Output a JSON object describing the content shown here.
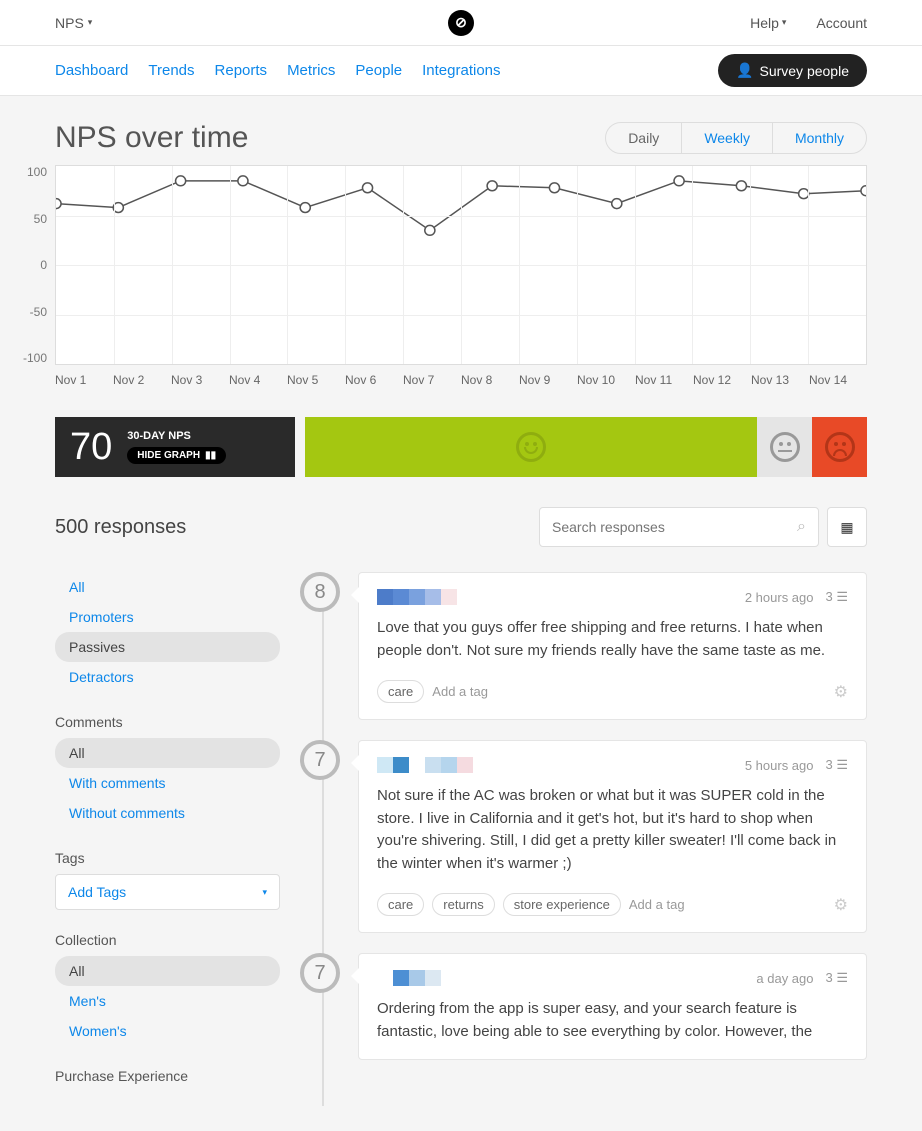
{
  "topbar": {
    "nps_label": "NPS",
    "help_label": "Help",
    "account_label": "Account"
  },
  "nav": {
    "tabs": [
      "Dashboard",
      "Trends",
      "Reports",
      "Metrics",
      "People",
      "Integrations"
    ],
    "survey_btn": "Survey people"
  },
  "chart_title": "NPS over time",
  "period": {
    "daily": "Daily",
    "weekly": "Weekly",
    "monthly": "Monthly"
  },
  "chart_data": {
    "type": "line",
    "title": "NPS over time",
    "xlabel": "",
    "ylabel": "",
    "ylim": [
      -100,
      100
    ],
    "yticks": [
      100,
      50,
      0,
      -50,
      -100
    ],
    "categories": [
      "Nov 1",
      "Nov 2",
      "Nov 3",
      "Nov 4",
      "Nov 5",
      "Nov 6",
      "Nov 7",
      "Nov 8",
      "Nov 9",
      "Nov 10",
      "Nov 11",
      "Nov 12",
      "Nov 13",
      "Nov 14"
    ],
    "values": [
      62,
      58,
      85,
      85,
      58,
      78,
      35,
      80,
      78,
      62,
      85,
      80,
      72,
      75
    ]
  },
  "nps_box": {
    "score": "70",
    "label": "30-DAY NPS",
    "hide_graph": "HIDE GRAPH"
  },
  "responses_count": "500 responses",
  "search": {
    "placeholder": "Search responses"
  },
  "filters": {
    "type": {
      "items": [
        "All",
        "Promoters",
        "Passives",
        "Detractors"
      ],
      "active": 2
    },
    "comments": {
      "title": "Comments",
      "items": [
        "All",
        "With comments",
        "Without comments"
      ],
      "active": 0
    },
    "tags": {
      "title": "Tags",
      "add_label": "Add Tags"
    },
    "collection": {
      "title": "Collection",
      "items": [
        "All",
        "Men's",
        "Women's"
      ],
      "active": 0
    },
    "purchase": {
      "title": "Purchase Experience"
    }
  },
  "responses": [
    {
      "score": "8",
      "time": "2 hours ago",
      "meta_count": "3",
      "text": "Love that you guys offer free shipping and free returns. I hate when people don't. Not sure my friends really have the same taste as me.",
      "tags": [
        "care"
      ],
      "add_tag": "Add a tag",
      "pixels": [
        "#4d7cc9",
        "#5b8ad4",
        "#7aa1de",
        "#a6bde8",
        "#f7e4e6"
      ]
    },
    {
      "score": "7",
      "time": "5 hours ago",
      "meta_count": "3",
      "text": "Not sure if the AC was broken or what but it was SUPER cold in the store. I live in California and it get's hot, but it's hard to shop when you're shivering. Still, I did get a pretty killer sweater! I'll come back in the winter when it's warmer ;)",
      "tags": [
        "care",
        "returns",
        "store experience"
      ],
      "add_tag": "Add a tag",
      "pixels": [
        "#cfe8f5",
        "#3d8cc9",
        "#ffffff",
        "#c9dff0",
        "#b5d5ed",
        "#f5dbe0"
      ]
    },
    {
      "score": "7",
      "time": "a day ago",
      "meta_count": "3",
      "text": "Ordering from the app is super easy, and your search feature is fantastic, love being able to see everything by color. However, the",
      "tags": [],
      "add_tag": "",
      "pixels": [
        "#ffffff",
        "#4d8fd4",
        "#a8c9e8",
        "#dce8f2"
      ]
    }
  ]
}
